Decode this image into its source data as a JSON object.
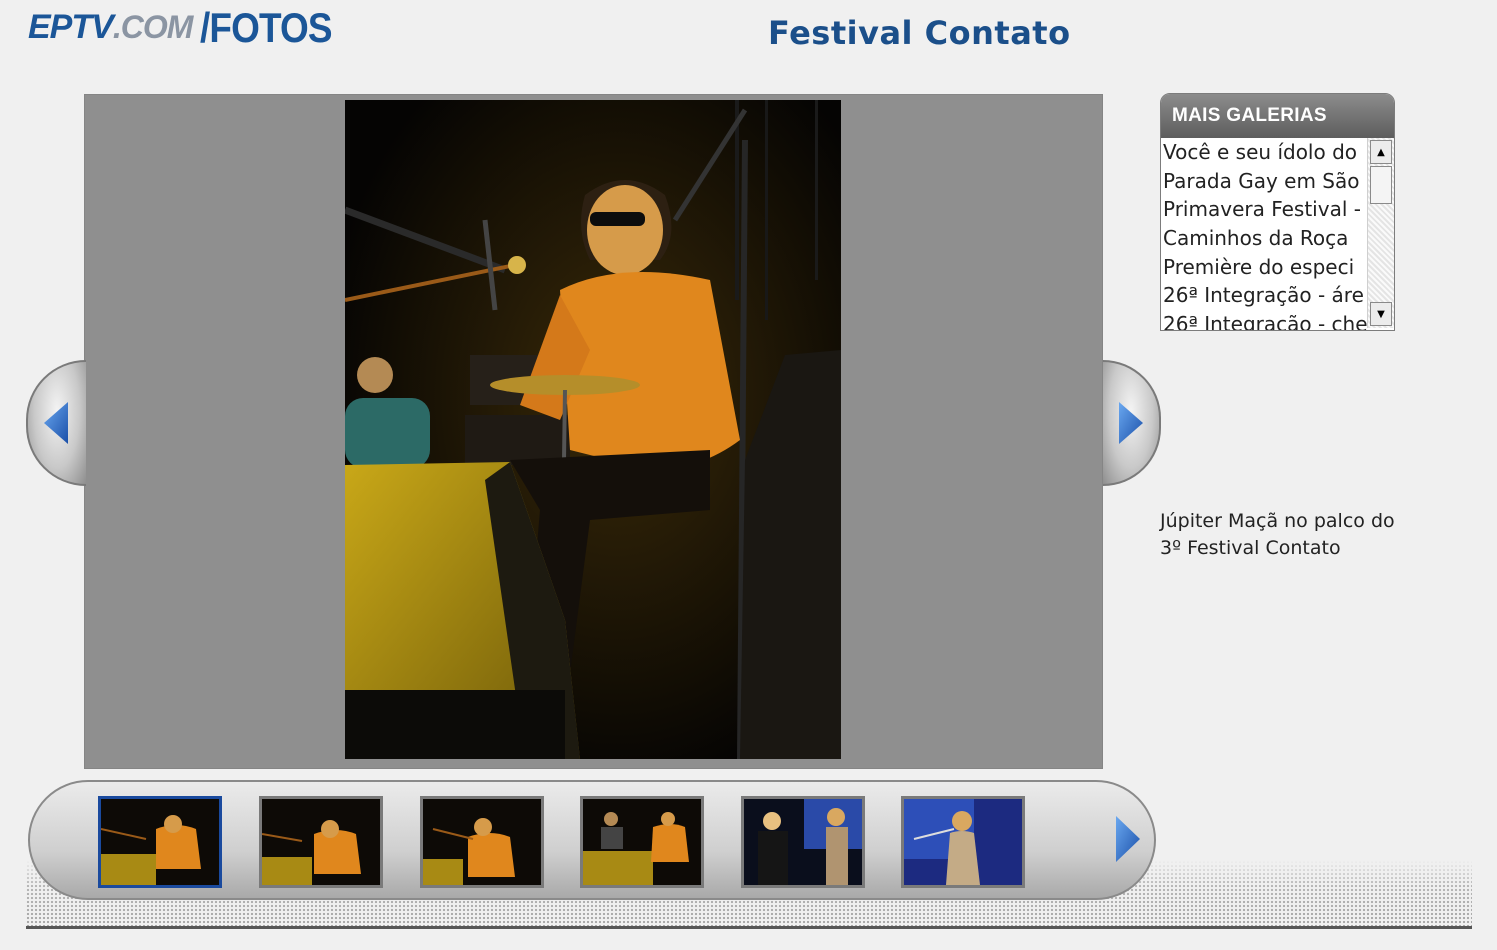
{
  "header": {
    "logo_eptv": "EPTV",
    "logo_dotcom": ".COM",
    "logo_fotos": "/FOTOS",
    "title": "Festival Contato"
  },
  "viewer": {
    "prev_icon": "arrow-left-icon",
    "next_icon": "arrow-right-icon",
    "photo_caption": "Júpiter Maçã no palco do 3º Festival Contato"
  },
  "galleries": {
    "header": "MAIS GALERIAS",
    "items": [
      "Você e seu ídolo do",
      "Parada Gay em São",
      "Primavera Festival -",
      "Caminhos da Roça",
      "Première do especi",
      "26ª Integração - áre",
      "26ª Integração - che"
    ]
  },
  "thumbnails": {
    "count": 6,
    "active_index": 0,
    "next_icon": "arrow-right-icon"
  },
  "colors": {
    "brand_blue": "#1b5698",
    "title_blue": "#1b4f8a",
    "arrow_blue": "#2a6fd0",
    "viewer_gray": "#8f8f8f"
  }
}
